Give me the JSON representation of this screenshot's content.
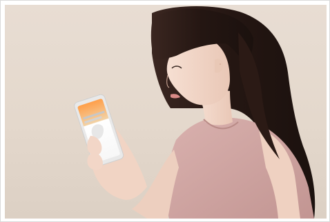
{
  "scene": {
    "description_icon": "person-reading-phone",
    "colors": {
      "background": "#e6dbd0",
      "hair": "#2a1b16",
      "skin": "#f1d6c6",
      "top": "#cfa3a0",
      "phone": "#f3f3f3"
    }
  }
}
